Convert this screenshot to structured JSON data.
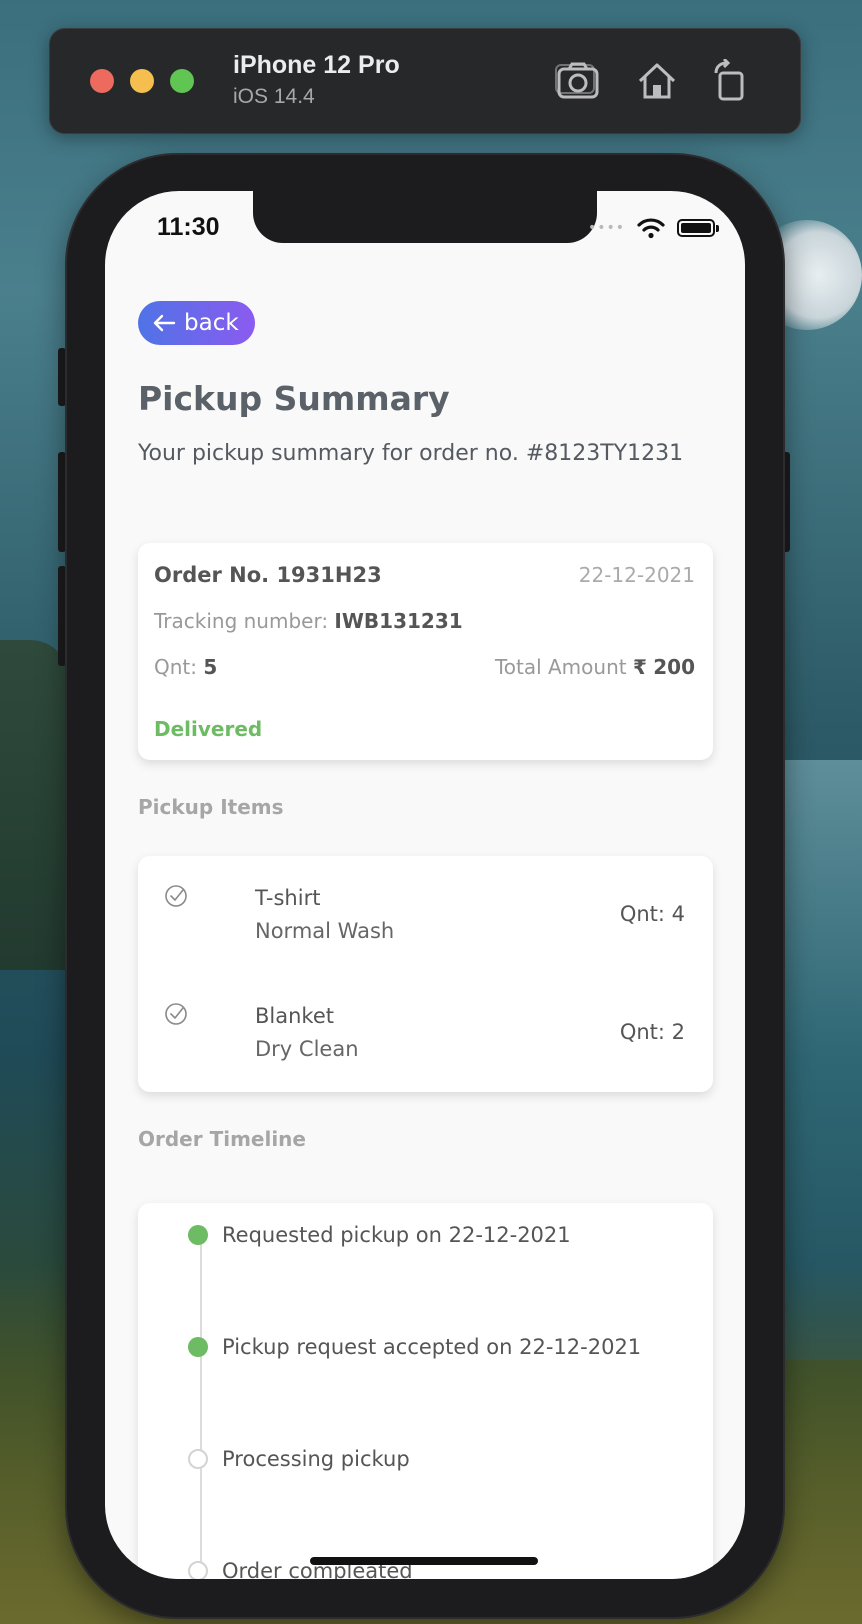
{
  "simulator": {
    "device_name": "iPhone 12 Pro",
    "os_version": "iOS 14.4"
  },
  "status_bar": {
    "time": "11:30"
  },
  "header": {
    "back_label": "back",
    "title": "Pickup Summary",
    "subtitle_prefix": "Your pickup summary for order no.",
    "subtitle_order": "#8123TY1231"
  },
  "order_card": {
    "order_no": "Order No. 1931H23",
    "date": "22-12-2021",
    "tracking_label": "Tracking number:",
    "tracking_value": "IWB131231",
    "qty_label": "Qnt:",
    "qty_value": "5",
    "total_label": "Total Amount",
    "currency": "₹",
    "total_value": "200",
    "status": "Delivered",
    "status_color": "#6dbb63"
  },
  "pickup_items": {
    "label": "Pickup Items",
    "items": [
      {
        "name": "T-shirt",
        "service": "Normal Wash",
        "qty": "Qnt: 4"
      },
      {
        "name": "Blanket",
        "service": "Dry Clean",
        "qty": "Qnt: 2"
      }
    ]
  },
  "timeline": {
    "label": "Order Timeline",
    "events": [
      {
        "text": "Requested pickup on 22-12-2021",
        "done": true
      },
      {
        "text": "Pickup request accepted on 22-12-2021",
        "done": true
      },
      {
        "text": "Processing pickup",
        "done": false
      },
      {
        "text": "Order compleated",
        "done": false
      }
    ]
  },
  "colors": {
    "accent_gradient_start": "#4f73e6",
    "accent_gradient_end": "#8b5bf0",
    "done": "#6dbb63"
  }
}
